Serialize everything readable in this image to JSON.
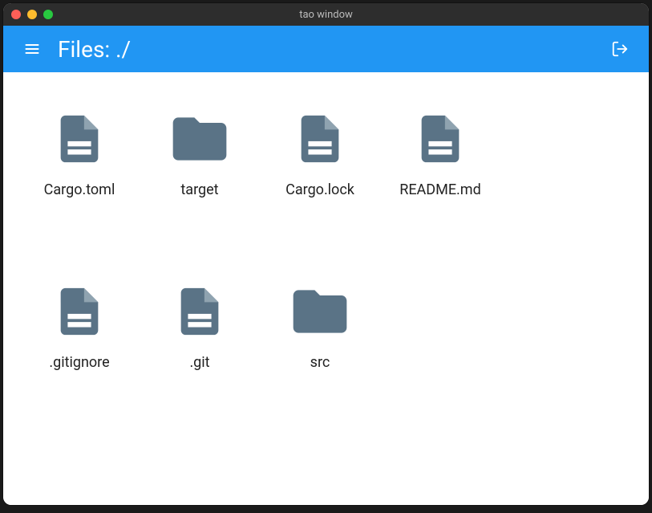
{
  "window": {
    "title": "tao window"
  },
  "toolbar": {
    "title": "Files: ./"
  },
  "items": [
    {
      "name": "Cargo.toml",
      "type": "file"
    },
    {
      "name": "target",
      "type": "folder"
    },
    {
      "name": "Cargo.lock",
      "type": "file"
    },
    {
      "name": "README.md",
      "type": "file"
    },
    {
      "name": ".gitignore",
      "type": "file"
    },
    {
      "name": ".git",
      "type": "file"
    },
    {
      "name": "src",
      "type": "folder"
    }
  ],
  "colors": {
    "accent": "#2196f3",
    "icon": "#5a7386"
  }
}
